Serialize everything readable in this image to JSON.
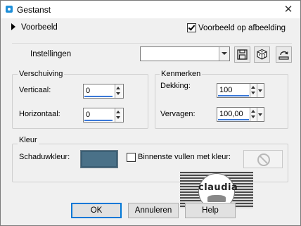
{
  "window": {
    "title": "Gestanst",
    "close_glyph": "✕"
  },
  "preview": {
    "label": "Voorbeeld",
    "on_image_label": "Voorbeeld op afbeelding",
    "on_image_checked": true
  },
  "settings": {
    "label": "Instellingen",
    "selected_value": ""
  },
  "toolbar": {
    "buttons": [
      "save-icon",
      "randomize-dice-icon",
      "reset-icon"
    ]
  },
  "displacement": {
    "title": "Verschuiving",
    "vertical_label": "Verticaal:",
    "vertical_value": "0",
    "horizontal_label": "Horizontaal:",
    "horizontal_value": "0"
  },
  "properties": {
    "title": "Kenmerken",
    "opacity_label": "Dekking:",
    "opacity_value": "100",
    "blur_label": "Vervagen:",
    "blur_value": "100,00"
  },
  "color": {
    "title": "Kleur",
    "shadow_label": "Schaduwkleur:",
    "shadow_color": "#4a7188",
    "fill_inside_label": "Binnenste vullen met kleur:",
    "fill_inside_checked": false
  },
  "watermark": {
    "text": "claudia"
  },
  "buttons": {
    "ok": "OK",
    "cancel": "Annuleren",
    "help": "Help"
  }
}
